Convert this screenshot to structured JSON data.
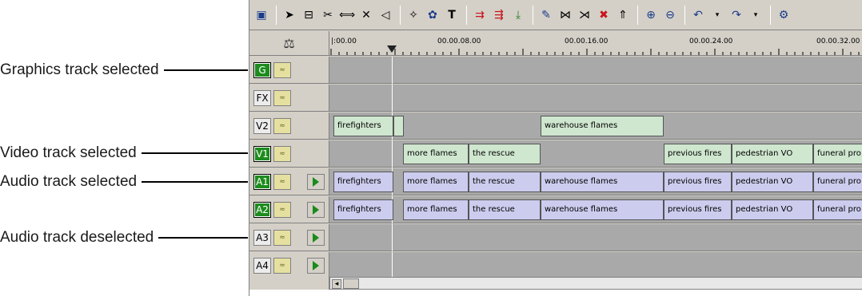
{
  "callouts": {
    "graphics": "Graphics track selected",
    "video": "Video track selected",
    "audio_sel": "Audio track selected",
    "audio_desel": "Audio track deselected"
  },
  "toolbar": {
    "icons": [
      "save-icon",
      "pointer-icon",
      "trim-icon",
      "razor-icon",
      "split-icon",
      "delete-icon",
      "audio-icon",
      "effects-icon",
      "transitions-icon",
      "text-icon",
      "move-left-icon",
      "move-right-icon",
      "insert-icon",
      "match-icon",
      "link-icon",
      "unlink-icon",
      "remove-icon",
      "lift-icon",
      "zoom-in-icon",
      "zoom-out-icon",
      "undo-icon",
      "redo-icon",
      "settings-icon"
    ]
  },
  "ruler": {
    "labels": [
      "|:00.00",
      "00.00.08.00",
      "00.00.16.00",
      "00.00.24.00",
      "00.00.32.00"
    ]
  },
  "tracks": [
    {
      "id": "G",
      "selected": true,
      "has_play": false,
      "clips": []
    },
    {
      "id": "FX",
      "selected": false,
      "has_play": false,
      "clips": []
    },
    {
      "id": "V2",
      "selected": false,
      "has_play": false,
      "clips": [
        {
          "label": "firefighters"
        },
        {
          "label": ""
        },
        {
          "label": "warehouse flames"
        }
      ]
    },
    {
      "id": "V1",
      "selected": true,
      "has_play": false,
      "clips": [
        {
          "label": "more flames"
        },
        {
          "label": "the rescue"
        },
        {
          "label": "previous fires"
        },
        {
          "label": "pedestrian VO"
        },
        {
          "label": "funeral pro"
        }
      ]
    },
    {
      "id": "A1",
      "selected": true,
      "has_play": true,
      "clips": [
        {
          "label": "firefighters"
        },
        {
          "label": "more flames"
        },
        {
          "label": "the rescue"
        },
        {
          "label": "warehouse flames"
        },
        {
          "label": "previous fires"
        },
        {
          "label": "pedestrian VO"
        },
        {
          "label": "funeral pro"
        }
      ]
    },
    {
      "id": "A2",
      "selected": true,
      "has_play": true,
      "clips": [
        {
          "label": "firefighters"
        },
        {
          "label": "more flames"
        },
        {
          "label": "the rescue"
        },
        {
          "label": "warehouse flames"
        },
        {
          "label": "previous fires"
        },
        {
          "label": "pedestrian VO"
        },
        {
          "label": "funeral pro"
        }
      ]
    },
    {
      "id": "A3",
      "selected": false,
      "has_play": true,
      "clips": []
    },
    {
      "id": "A4",
      "selected": false,
      "has_play": true,
      "clips": []
    }
  ]
}
